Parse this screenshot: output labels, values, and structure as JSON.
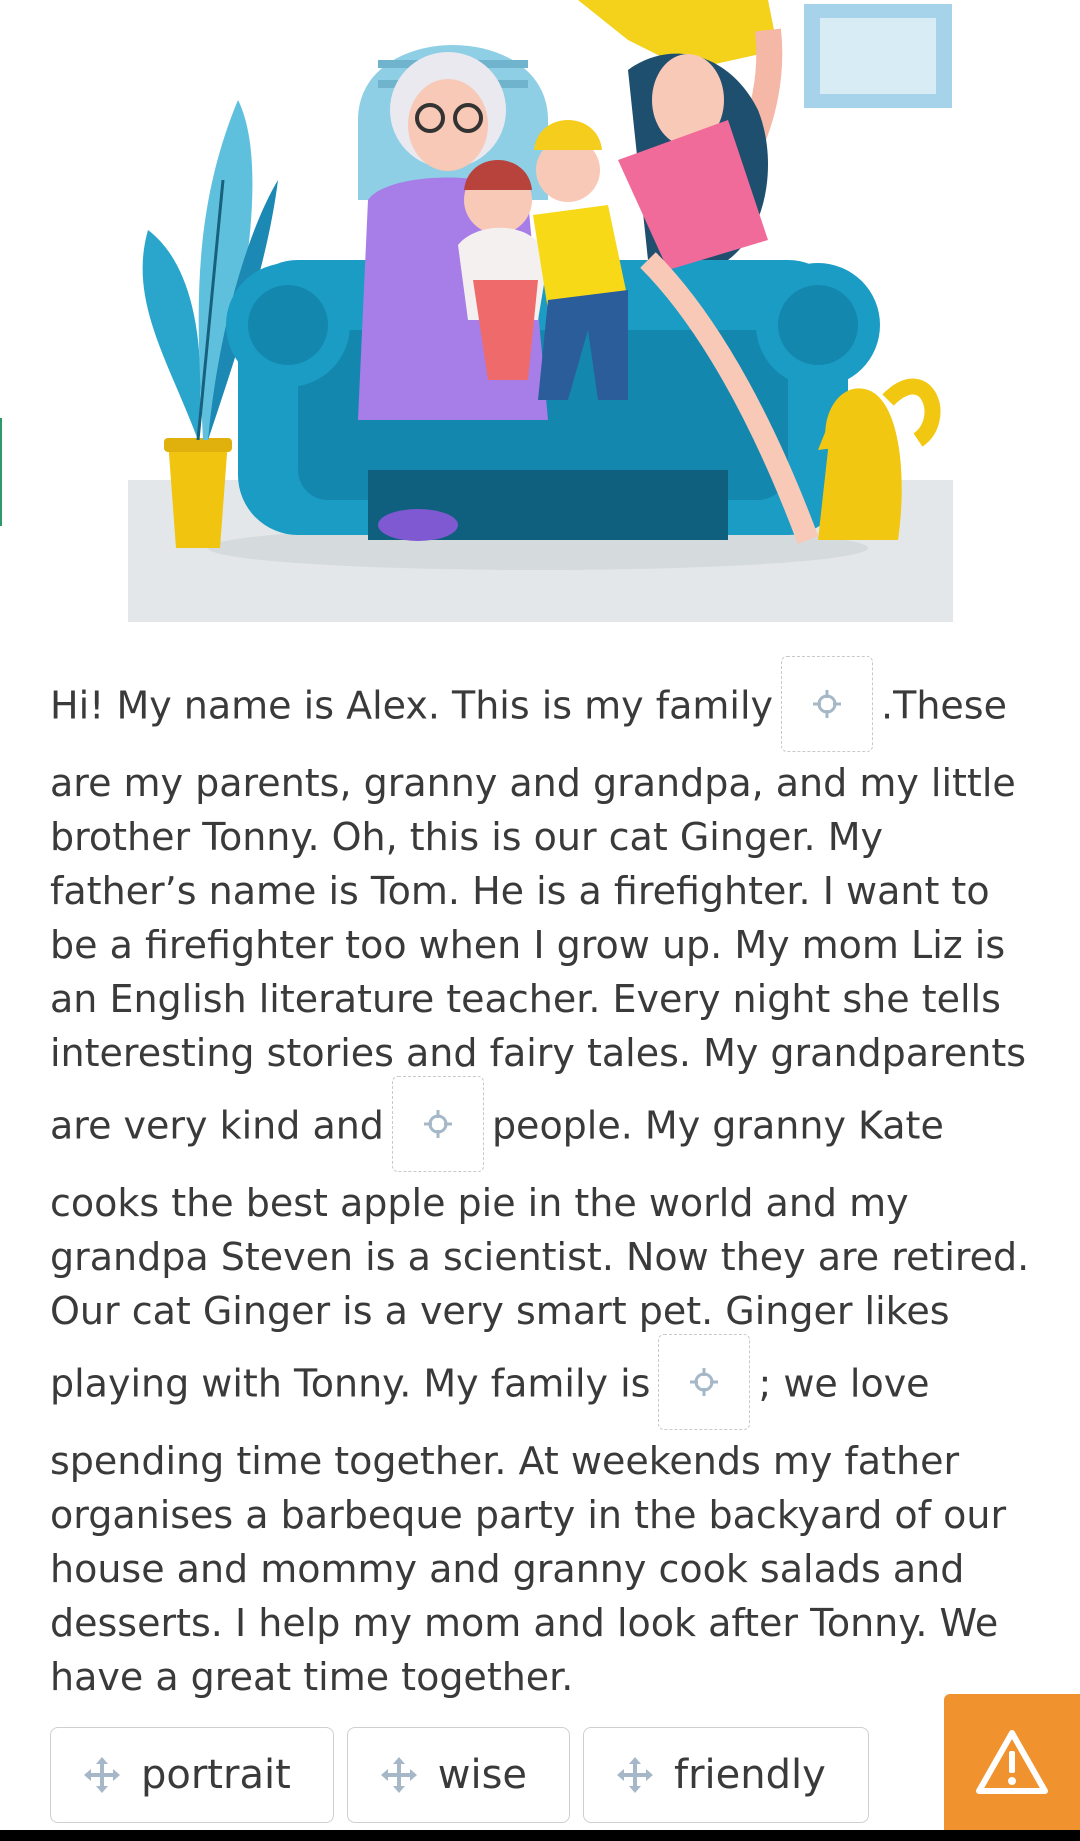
{
  "passage": {
    "p1_before": "Hi! My name is Alex. This is my family",
    "p1_after": ".These",
    "p2_before": "are my parents, granny and grandpa, and my little brother Tonny. Oh, this is our cat Ginger. My father’s name is Tom. He is a firefighter. I want to be a firefighter too when I grow up. My mom Liz is an English literature teacher. Every night she tells interesting stories and fairy tales. My grandparents are very kind and",
    "p2_after": "people. My granny Kate",
    "p3_before": "cooks the best apple pie in the world and my grandpa Steven is a scientist. Now they are retired. Our cat Ginger is a very smart pet. Ginger likes playing with Tonny. My family is",
    "p3_after": "; we love",
    "p4": "spending time together. At weekends my father organises a barbeque party in the backyard of our house and mommy and granny cook salads and desserts. I help my mom and look after Tonny. We have a great time together."
  },
  "options": [
    "portrait",
    "wise",
    "friendly"
  ],
  "icons": {
    "slot": "crosshair-icon",
    "chip": "move-icon",
    "alert": "warning-icon"
  },
  "colors": {
    "accent_orange": "#f0922e",
    "sofa_blue": "#1a9cc4",
    "cat_yellow": "#f2c712"
  }
}
